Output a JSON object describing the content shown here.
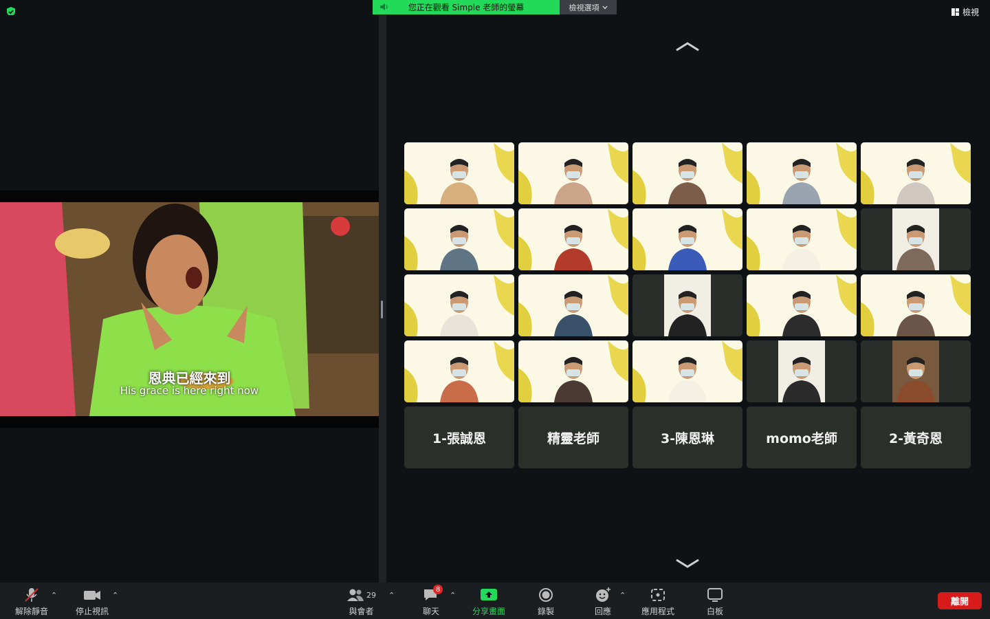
{
  "banner": {
    "message": "您正在觀看 Simple 老師的螢幕",
    "options_label": "檢視選項"
  },
  "view_label": "檢視",
  "video": {
    "subtitle_zh": "恩典已經來到",
    "subtitle_en": "His grace is here right now"
  },
  "participants": [
    {
      "tone": "#d8b07e",
      "bg": "yellow",
      "active": true
    },
    {
      "tone": "#caa58a",
      "bg": "yellow"
    },
    {
      "tone": "#7b5d4a",
      "bg": "yellow"
    },
    {
      "tone": "#9aa3b0",
      "bg": "yellow"
    },
    {
      "tone": "#d0c8c0",
      "bg": "yellow"
    },
    {
      "tone": "#5f7484",
      "bg": "yellow"
    },
    {
      "tone": "#b33b2b",
      "bg": "yellow"
    },
    {
      "tone": "#3a5cb8",
      "bg": "yellow"
    },
    {
      "tone": "#f4f1e2",
      "bg": "yellow"
    },
    {
      "tone": "#7d6a5a",
      "bg": "white"
    },
    {
      "tone": "#e9e3da",
      "bg": "yellow"
    },
    {
      "tone": "#39526a",
      "bg": "yellow"
    },
    {
      "tone": "#222222",
      "bg": "white"
    },
    {
      "tone": "#2c2c2c",
      "bg": "yellow"
    },
    {
      "tone": "#6b5548",
      "bg": "yellow"
    },
    {
      "tone": "#c86c4a",
      "bg": "yellow"
    },
    {
      "tone": "#4a3a33",
      "bg": "yellow"
    },
    {
      "tone": "#f4f1e2",
      "bg": "yellow"
    },
    {
      "tone": "#2b2b2b",
      "bg": "white"
    },
    {
      "tone": "#8a4c2c",
      "bg": "room"
    }
  ],
  "name_tiles": [
    "1-張誠恩",
    "精靈老師",
    "3-陳恩琳",
    "momo老師",
    "2-黃奇恩"
  ],
  "toolbar": {
    "unmute": "解除靜音",
    "stop_video": "停止視訊",
    "participants": "與會者",
    "participants_count": "29",
    "chat": "聊天",
    "chat_badge": "8",
    "share": "分享畫面",
    "record": "錄製",
    "reactions": "回應",
    "apps": "應用程式",
    "whiteboard": "白板",
    "leave": "離開"
  },
  "colors": {
    "accent": "#23d959",
    "leave": "#d71b1b",
    "tile_yellow": "#e6d24a"
  }
}
